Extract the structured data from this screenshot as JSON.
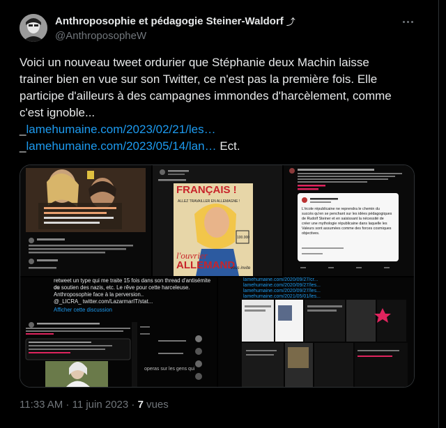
{
  "author": {
    "display_name": "Anthroposophie et pédagogie Steiner-Waldorf",
    "badge_glyph": "⤴",
    "handle": "@AnthroposopheW"
  },
  "tweet": {
    "line1": "Voici un nouveau tweet ordurier que Stéphanie deux Machin laisse",
    "line2": "trainer bien en vue sur son Twitter, ce n'est pas la première fois. Elle",
    "line3": "participe d'ailleurs à des campagnes immondes d'harcèlement, comme",
    "line4": "c'est ignoble...",
    "link1_prefix": "_",
    "link1": "lamehumaine.com/2023/02/21/les…",
    "link2_prefix": "_",
    "link2": "lamehumaine.com/2023/05/14/lan…",
    "after_link2": " Ect."
  },
  "media": {
    "poster_line1": "FRANÇAIS !",
    "poster_line2": "ALLEZ TRAVAILLER EN ALLEMAGNE !",
    "poster_bottom1": "l'ouvrier",
    "poster_bottom2": "ALLEMAND",
    "poster_side": "vous invite",
    "poster_badge": "100.000",
    "card_text": "L'école républicaine ne reprendra le chemin du succès qu'en se penchant sur les idées pédagogiques de Rudolf Steiner et en saisissant la nécessité de créer une mythologie républicaine dans laquelle les Valeurs sont assumées comme des forces cosmiques objectives.",
    "card_author": "Mouvement",
    "c4_line1": "retweet un type qui me traite 15 fois dans son thread d'antisémite ou",
    "c4_line2": "de soutien des nazis, etc. Le rêve pour cette harceleuse.",
    "c4_line3": "Anthroposophie face à la perversion..",
    "c4_line4": "@_LICRA_ twitter.com/LazarmarIT/stat...",
    "c4_link": "Afficher cette discussion",
    "c4_caption": "operas sur les gens qui",
    "c5_links": [
      "lamehumaine.com/2020/09/27/cr...",
      "lamehumaine.com/2020/09/27/les...",
      "lamehumaine.com/2020/09/27/les...",
      "lamehumaine.com/2021/05/01/les..."
    ]
  },
  "meta": {
    "time": "11:33 AM",
    "separator1": " · ",
    "date": "11 juin 2023",
    "separator2": " · ",
    "views_count": "7",
    "views_label": " vues"
  }
}
